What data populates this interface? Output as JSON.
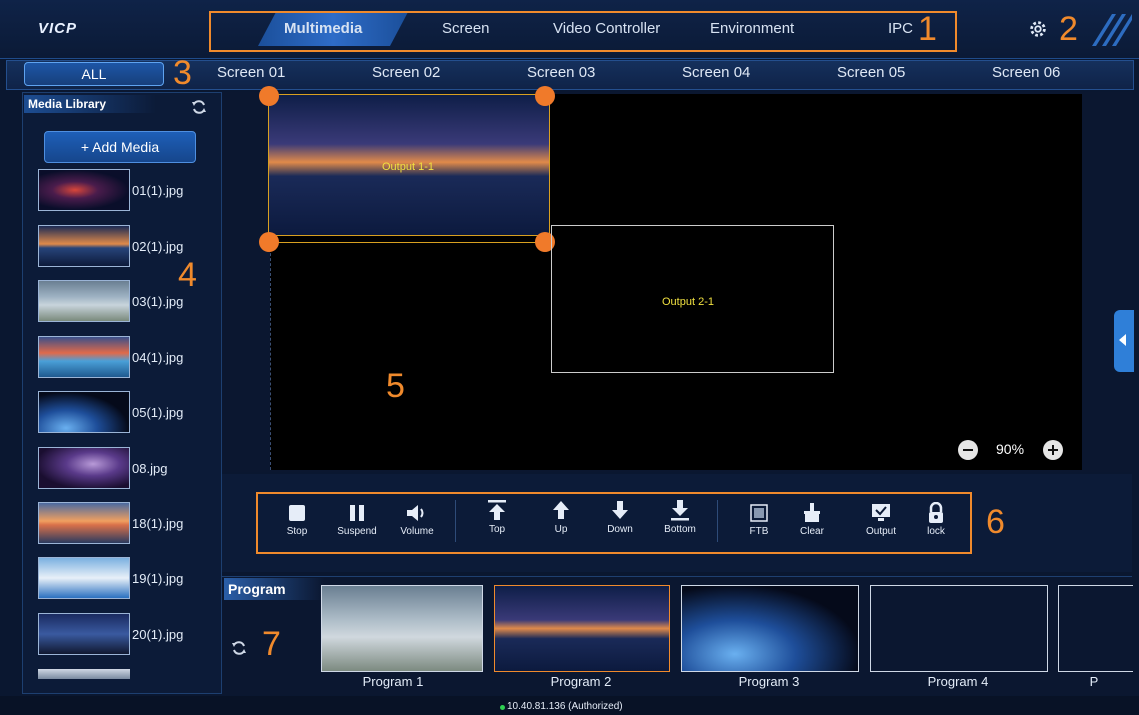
{
  "app": {
    "logo": "VICP"
  },
  "nav": {
    "tabs": [
      "Multimedia",
      "Screen",
      "Video Controller",
      "Environment",
      "IPC"
    ],
    "active": "Multimedia"
  },
  "screens": {
    "all_label": "ALL",
    "tabs": [
      "Screen 01",
      "Screen 02",
      "Screen 03",
      "Screen 04",
      "Screen 05",
      "Screen 06"
    ]
  },
  "annotations": [
    "1",
    "2",
    "3",
    "4",
    "5",
    "6",
    "7"
  ],
  "media_library": {
    "title": "Media Library",
    "add_label": "+ Add Media",
    "items": [
      "01(1).jpg",
      "02(1).jpg",
      "03(1).jpg",
      "04(1).jpg",
      "05(1).jpg",
      "08.jpg",
      "18(1).jpg",
      "19(1).jpg",
      "20(1).jpg"
    ]
  },
  "canvas": {
    "outputs": [
      "Output 1-1",
      "Output 2-1"
    ],
    "zoom": "90%"
  },
  "toolbar": {
    "buttons": [
      "Stop",
      "Suspend",
      "Volume",
      "Top",
      "Up",
      "Down",
      "Bottom",
      "FTB",
      "Clear",
      "Output",
      "lock"
    ]
  },
  "program": {
    "title": "Program",
    "items": [
      "Program 1",
      "Program 2",
      "Program 3",
      "Program 4",
      "P"
    ],
    "selected": "Program 2"
  },
  "status": {
    "text": "10.40.81.136 (Authorized)"
  },
  "colors": {
    "accent": "#f08a2c",
    "highlight": "#2e6cc8",
    "output_border": "#d8a020",
    "bg": "#0a1730"
  }
}
